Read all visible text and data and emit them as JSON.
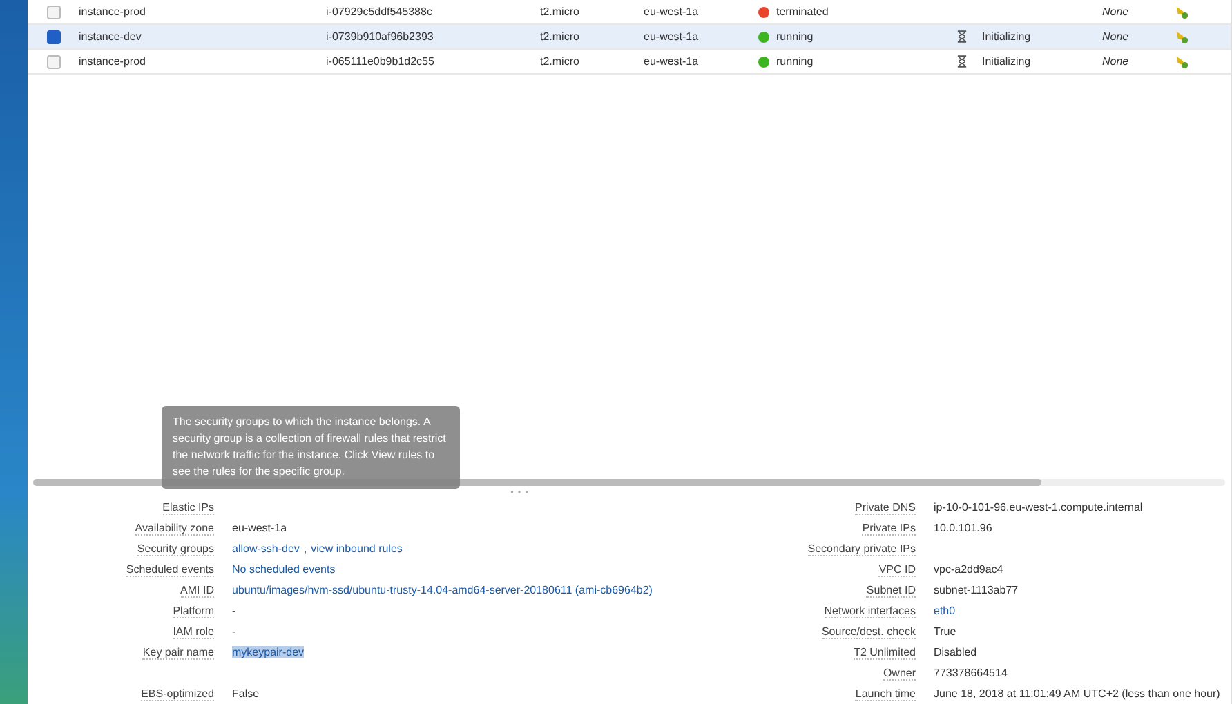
{
  "instances": [
    {
      "name": "instance-prod",
      "instance_id": "i-07929c5ddf545388c",
      "type": "t2.micro",
      "zone": "eu-west-1a",
      "state": {
        "label": "terminated",
        "color": "#e8452c"
      },
      "alarm": "None",
      "selected": false
    },
    {
      "name": "instance-dev",
      "instance_id": "i-0739b910af96b2393",
      "type": "t2.micro",
      "zone": "eu-west-1a",
      "state": {
        "label": "running",
        "color": "#3cb521"
      },
      "status_check": "Initializing",
      "alarm": "None",
      "selected": true
    },
    {
      "name": "instance-prod",
      "instance_id": "i-065111e0b9b1d2c55",
      "type": "t2.micro",
      "zone": "eu-west-1a",
      "state": {
        "label": "running",
        "color": "#3cb521"
      },
      "status_check": "Initializing",
      "alarm": "None",
      "selected": false
    }
  ],
  "tooltip": "The security groups to which the instance belongs. A security group is a collection of firewall rules that restrict the network traffic for the instance. Click View rules to see the rules for the specific group.",
  "details_left": [
    {
      "label": "Elastic IPs"
    },
    {
      "label": "Availability zone",
      "parts": [
        {
          "text": "eu-west-1a",
          "kind": "plain"
        }
      ]
    },
    {
      "label": "Security groups",
      "parts": [
        {
          "text": "allow-ssh-dev",
          "kind": "link"
        },
        {
          "text": ",",
          "kind": "plain"
        },
        {
          "text": "view inbound rules",
          "kind": "link"
        }
      ]
    },
    {
      "label": "Scheduled events",
      "parts": [
        {
          "text": "No scheduled events",
          "kind": "link"
        }
      ]
    },
    {
      "label": "AMI ID",
      "parts": [
        {
          "text": "ubuntu/images/hvm-ssd/ubuntu-trusty-14.04-amd64-server-20180611 (ami-cb6964b2)",
          "kind": "link"
        }
      ]
    },
    {
      "label": "Platform",
      "parts": [
        {
          "text": "-",
          "kind": "plain"
        }
      ]
    },
    {
      "label": "IAM role",
      "parts": [
        {
          "text": "-",
          "kind": "plain"
        }
      ]
    },
    {
      "label": "Key pair name",
      "parts": [
        {
          "text": "mykeypair-dev",
          "kind": "highlight"
        }
      ]
    },
    {
      "label": "EBS-optimized",
      "parts": [
        {
          "text": "False",
          "kind": "plain"
        }
      ],
      "gap_before": true
    }
  ],
  "details_right": [
    {
      "label": "Private DNS",
      "parts": [
        {
          "text": "ip-10-0-101-96.eu-west-1.compute.internal",
          "kind": "plain"
        }
      ]
    },
    {
      "label": "Private IPs",
      "parts": [
        {
          "text": "10.0.101.96",
          "kind": "plain"
        }
      ]
    },
    {
      "label": "Secondary private IPs"
    },
    {
      "label": "VPC ID",
      "parts": [
        {
          "text": "vpc-a2dd9ac4",
          "kind": "plain"
        }
      ]
    },
    {
      "label": "Subnet ID",
      "parts": [
        {
          "text": "subnet-1113ab77",
          "kind": "plain"
        }
      ]
    },
    {
      "label": "Network interfaces",
      "parts": [
        {
          "text": "eth0",
          "kind": "link"
        }
      ]
    },
    {
      "label": "Source/dest. check",
      "parts": [
        {
          "text": "True",
          "kind": "plain"
        }
      ]
    },
    {
      "label": "T2 Unlimited",
      "parts": [
        {
          "text": "Disabled",
          "kind": "plain"
        }
      ]
    },
    {
      "label": "Owner",
      "parts": [
        {
          "text": "773378664514",
          "kind": "plain"
        }
      ]
    },
    {
      "label": "Launch time",
      "parts": [
        {
          "text": "June 18, 2018 at 11:01:49 AM UTC+2 (less than one hour)",
          "kind": "plain"
        }
      ]
    }
  ]
}
